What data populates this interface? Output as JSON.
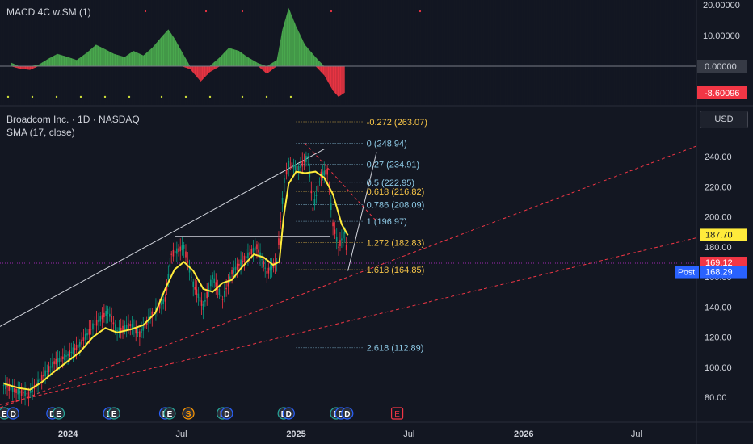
{
  "macd_panel": {
    "title": "MACD 4C w.SM (1)",
    "axis_ticks": [
      20,
      10
    ],
    "axis_tick_labels": [
      "20.00000",
      "10.00000"
    ],
    "zero_badge": "0.00000",
    "value_badge": "-8.60096",
    "histogram": [
      {
        "date": "2023-10-01",
        "v": 1.2
      },
      {
        "date": "2023-10-15",
        "v": -0.8
      },
      {
        "date": "2023-11-01",
        "v": -1.2
      },
      {
        "date": "2023-11-15",
        "v": 0.5
      },
      {
        "date": "2023-12-01",
        "v": 2.5
      },
      {
        "date": "2023-12-15",
        "v": 4.0
      },
      {
        "date": "2024-01-01",
        "v": 3.0
      },
      {
        "date": "2024-01-15",
        "v": 2.0
      },
      {
        "date": "2024-02-01",
        "v": 4.5
      },
      {
        "date": "2024-02-15",
        "v": 7.0
      },
      {
        "date": "2024-03-01",
        "v": 5.5
      },
      {
        "date": "2024-03-15",
        "v": 4.0
      },
      {
        "date": "2024-04-01",
        "v": 3.0
      },
      {
        "date": "2024-04-15",
        "v": 5.0
      },
      {
        "date": "2024-05-01",
        "v": 3.5
      },
      {
        "date": "2024-05-15",
        "v": 6.0
      },
      {
        "date": "2024-06-01",
        "v": 10.0
      },
      {
        "date": "2024-06-10",
        "v": 12.0
      },
      {
        "date": "2024-06-20",
        "v": 9.0
      },
      {
        "date": "2024-07-01",
        "v": 5.0
      },
      {
        "date": "2024-07-15",
        "v": -1.0
      },
      {
        "date": "2024-08-01",
        "v": -5.0
      },
      {
        "date": "2024-08-15",
        "v": -2.0
      },
      {
        "date": "2024-09-01",
        "v": 3.0
      },
      {
        "date": "2024-09-15",
        "v": 6.0
      },
      {
        "date": "2024-10-01",
        "v": 5.0
      },
      {
        "date": "2024-10-15",
        "v": 3.0
      },
      {
        "date": "2024-11-01",
        "v": 1.0
      },
      {
        "date": "2024-11-15",
        "v": -2.5
      },
      {
        "date": "2024-12-01",
        "v": 2.0
      },
      {
        "date": "2024-12-10",
        "v": 12.0
      },
      {
        "date": "2024-12-20",
        "v": 19.0
      },
      {
        "date": "2025-01-01",
        "v": 13.0
      },
      {
        "date": "2025-01-15",
        "v": 7.0
      },
      {
        "date": "2025-02-01",
        "v": 3.0
      },
      {
        "date": "2025-02-15",
        "v": -3.0
      },
      {
        "date": "2025-03-01",
        "v": -8.0
      },
      {
        "date": "2025-03-10",
        "v": -10.0
      },
      {
        "date": "2025-03-20",
        "v": -8.6
      }
    ]
  },
  "price_panel": {
    "symbol_line": "Broadcom Inc. · 1D · NASDAQ",
    "indicator_line": "SMA (17, close)",
    "currency": "USD",
    "y_ticks": [
      80,
      100,
      120,
      140,
      160,
      180,
      200,
      220,
      240
    ],
    "y_tick_labels": [
      "80.00",
      "100.00",
      "120.00",
      "140.00",
      "160.00",
      "180.00",
      "200.00",
      "220.00",
      "240.00"
    ],
    "price_badges": [
      {
        "label": "187.70",
        "value": 187.7,
        "color": "#ffeb3b",
        "text_color": "#131722"
      },
      {
        "label": "169.12",
        "value": 169.12,
        "color": "#f23645",
        "text_color": "#ffffff"
      },
      {
        "label": "168.29",
        "value": 168.29,
        "color": "#2962ff",
        "text_color": "#ffffff",
        "prefix": "Post"
      }
    ],
    "fib_levels": [
      {
        "label": "-0.272 (263.07)",
        "value": 263.07,
        "color": "#f7c548"
      },
      {
        "label": "0 (248.94)",
        "value": 248.94,
        "color": "#8ecae6"
      },
      {
        "label": "0.27 (234.91)",
        "value": 234.91,
        "color": "#8ecae6"
      },
      {
        "label": "0.5 (222.95)",
        "value": 222.95,
        "color": "#8ecae6"
      },
      {
        "label": "0.618 (216.82)",
        "value": 216.82,
        "color": "#f7c548"
      },
      {
        "label": "0.786 (208.09)",
        "value": 208.09,
        "color": "#8ecae6"
      },
      {
        "label": "1 (196.97)",
        "value": 196.97,
        "color": "#8ecae6"
      },
      {
        "label": "1.272 (182.83)",
        "value": 182.83,
        "color": "#f7c548"
      },
      {
        "label": "1.618 (164.85)",
        "value": 164.85,
        "color": "#f7c548"
      },
      {
        "label": "2.618 (112.89)",
        "value": 112.89,
        "color": "#8ecae6"
      }
    ],
    "sma_series": [
      {
        "date": "2023-09-20",
        "v": 89
      },
      {
        "date": "2023-10-15",
        "v": 86
      },
      {
        "date": "2023-11-01",
        "v": 85
      },
      {
        "date": "2023-11-20",
        "v": 90
      },
      {
        "date": "2023-12-10",
        "v": 97
      },
      {
        "date": "2024-01-01",
        "v": 104
      },
      {
        "date": "2024-01-20",
        "v": 110
      },
      {
        "date": "2024-02-10",
        "v": 120
      },
      {
        "date": "2024-03-01",
        "v": 126
      },
      {
        "date": "2024-03-20",
        "v": 123
      },
      {
        "date": "2024-04-10",
        "v": 125
      },
      {
        "date": "2024-05-01",
        "v": 128
      },
      {
        "date": "2024-05-20",
        "v": 136
      },
      {
        "date": "2024-06-05",
        "v": 152
      },
      {
        "date": "2024-06-20",
        "v": 165
      },
      {
        "date": "2024-07-05",
        "v": 170
      },
      {
        "date": "2024-07-20",
        "v": 164
      },
      {
        "date": "2024-08-05",
        "v": 152
      },
      {
        "date": "2024-08-20",
        "v": 150
      },
      {
        "date": "2024-09-05",
        "v": 156
      },
      {
        "date": "2024-09-20",
        "v": 158
      },
      {
        "date": "2024-10-05",
        "v": 166
      },
      {
        "date": "2024-10-25",
        "v": 175
      },
      {
        "date": "2024-11-10",
        "v": 173
      },
      {
        "date": "2024-11-25",
        "v": 168
      },
      {
        "date": "2024-12-05",
        "v": 170
      },
      {
        "date": "2024-12-12",
        "v": 200
      },
      {
        "date": "2024-12-20",
        "v": 222
      },
      {
        "date": "2025-01-01",
        "v": 230
      },
      {
        "date": "2025-01-15",
        "v": 229
      },
      {
        "date": "2025-02-01",
        "v": 230
      },
      {
        "date": "2025-02-15",
        "v": 226
      },
      {
        "date": "2025-03-01",
        "v": 215
      },
      {
        "date": "2025-03-15",
        "v": 195
      },
      {
        "date": "2025-03-25",
        "v": 187.7
      }
    ],
    "price_series": [
      {
        "date": "2023-09-20",
        "v": 88
      },
      {
        "date": "2023-10-10",
        "v": 84
      },
      {
        "date": "2023-10-30",
        "v": 82
      },
      {
        "date": "2023-11-20",
        "v": 93
      },
      {
        "date": "2023-12-10",
        "v": 103
      },
      {
        "date": "2024-01-01",
        "v": 108
      },
      {
        "date": "2024-01-20",
        "v": 115
      },
      {
        "date": "2024-02-10",
        "v": 127
      },
      {
        "date": "2024-03-05",
        "v": 137
      },
      {
        "date": "2024-03-20",
        "v": 124
      },
      {
        "date": "2024-04-10",
        "v": 128
      },
      {
        "date": "2024-04-25",
        "v": 122
      },
      {
        "date": "2024-05-15",
        "v": 135
      },
      {
        "date": "2024-06-05",
        "v": 145
      },
      {
        "date": "2024-06-15",
        "v": 175
      },
      {
        "date": "2024-07-05",
        "v": 180
      },
      {
        "date": "2024-07-20",
        "v": 155
      },
      {
        "date": "2024-08-05",
        "v": 140
      },
      {
        "date": "2024-08-20",
        "v": 160
      },
      {
        "date": "2024-09-05",
        "v": 145
      },
      {
        "date": "2024-09-20",
        "v": 163
      },
      {
        "date": "2024-10-10",
        "v": 172
      },
      {
        "date": "2024-10-30",
        "v": 180
      },
      {
        "date": "2024-11-15",
        "v": 163
      },
      {
        "date": "2024-12-01",
        "v": 170
      },
      {
        "date": "2024-12-13",
        "v": 224
      },
      {
        "date": "2024-12-20",
        "v": 235
      },
      {
        "date": "2025-01-05",
        "v": 232
      },
      {
        "date": "2025-01-20",
        "v": 240
      },
      {
        "date": "2025-01-28",
        "v": 205
      },
      {
        "date": "2025-02-10",
        "v": 228
      },
      {
        "date": "2025-02-20",
        "v": 230
      },
      {
        "date": "2025-03-01",
        "v": 195
      },
      {
        "date": "2025-03-10",
        "v": 180
      },
      {
        "date": "2025-03-20",
        "v": 190
      },
      {
        "date": "2025-03-25",
        "v": 169.12
      }
    ]
  },
  "time_axis": {
    "labels": [
      "2024",
      "Jul",
      "2025",
      "Jul",
      "2026",
      "Jul"
    ],
    "dates": [
      "2024-01-01",
      "2024-07-01",
      "2025-01-01",
      "2025-07-01",
      "2026-01-01",
      "2026-07-01"
    ],
    "domain": [
      "2023-09-14",
      "2026-10-05"
    ]
  },
  "events": [
    {
      "date": "2023-09-21",
      "label": "E",
      "kind": "earnings"
    },
    {
      "date": "2023-10-05",
      "label": "D",
      "kind": "dividend"
    },
    {
      "date": "2023-12-07",
      "label": "D",
      "kind": "dividend"
    },
    {
      "date": "2023-12-17",
      "label": "E",
      "kind": "earnings"
    },
    {
      "date": "2024-03-07",
      "label": "D",
      "kind": "dividend"
    },
    {
      "date": "2024-03-15",
      "label": "E",
      "kind": "earnings"
    },
    {
      "date": "2024-06-05",
      "label": "D",
      "kind": "dividend"
    },
    {
      "date": "2024-06-12",
      "label": "E",
      "kind": "earnings"
    },
    {
      "date": "2024-07-12",
      "label": "S",
      "kind": "split"
    },
    {
      "date": "2024-09-05",
      "label": "E",
      "kind": "earnings"
    },
    {
      "date": "2024-09-12",
      "label": "D",
      "kind": "dividend"
    },
    {
      "date": "2024-12-12",
      "label": "E",
      "kind": "earnings"
    },
    {
      "date": "2024-12-20",
      "label": "D",
      "kind": "dividend"
    },
    {
      "date": "2025-03-06",
      "label": "E",
      "kind": "earnings"
    },
    {
      "date": "2025-03-14",
      "label": "D",
      "kind": "dividend"
    },
    {
      "date": "2025-03-24",
      "label": "D",
      "kind": "dividend"
    },
    {
      "date": "2025-06-12",
      "label": "E",
      "kind": "upcoming-earnings"
    }
  ],
  "drawings": [
    {
      "kind": "trendline",
      "from": {
        "date": "2023-09-14",
        "v": 127
      },
      "to": {
        "date": "2025-02-15",
        "v": 245
      },
      "color": "#d1d4dc",
      "dash": false
    },
    {
      "kind": "hline",
      "from": {
        "date": "2024-06-20",
        "v": 187
      },
      "to": {
        "date": "2025-02-25",
        "v": 187
      },
      "color": "#d1d4dc",
      "dash": false
    },
    {
      "kind": "trendline",
      "from": {
        "date": "2025-03-25",
        "v": 164
      },
      "to": {
        "date": "2025-05-10",
        "v": 243
      },
      "color": "#d1d4dc",
      "dash": false
    },
    {
      "kind": "trendline",
      "from": {
        "date": "2023-09-14",
        "v": 73
      },
      "to": {
        "date": "2026-10-05",
        "v": 247
      },
      "color": "#f23645",
      "dash": true
    },
    {
      "kind": "trendline",
      "from": {
        "date": "2023-09-14",
        "v": 75
      },
      "to": {
        "date": "2026-10-05",
        "v": 186
      },
      "color": "#f23645",
      "dash": true
    },
    {
      "kind": "trendline",
      "from": {
        "date": "2025-01-15",
        "v": 249
      },
      "to": {
        "date": "2025-05-10",
        "v": 197
      },
      "color": "#f23645",
      "dash": true
    }
  ],
  "current_price_line": {
    "value": 169.12,
    "color": "#9c27b0"
  }
}
